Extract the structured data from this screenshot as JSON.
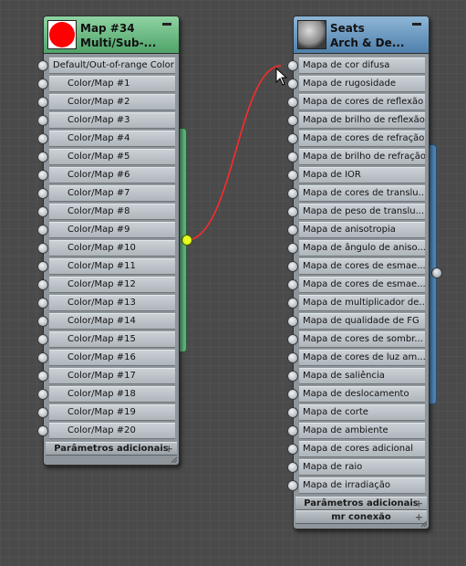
{
  "nodes": {
    "multi": {
      "title": "Map #34",
      "subtitle": "Multi/Sub-...",
      "thumb_color": "#ff0000",
      "header_color": "#5faf78",
      "slots": [
        "Default/Out-of-range Color",
        "Color/Map #1",
        "Color/Map #2",
        "Color/Map #3",
        "Color/Map #4",
        "Color/Map #5",
        "Color/Map #6",
        "Color/Map #7",
        "Color/Map #8",
        "Color/Map #9",
        "Color/Map #10",
        "Color/Map #11",
        "Color/Map #12",
        "Color/Map #13",
        "Color/Map #14",
        "Color/Map #15",
        "Color/Map #16",
        "Color/Map #17",
        "Color/Map #18",
        "Color/Map #19",
        "Color/Map #20"
      ],
      "rollouts": [
        "Parâmetros adicionais"
      ]
    },
    "seats": {
      "title": "Seats",
      "subtitle": "Arch & De...",
      "header_color": "#6a9cc6",
      "slots": [
        "Mapa de cor difusa",
        "Mapa de rugosidade",
        "Mapa de cores de reflexão",
        "Mapa de brilho de reflexão",
        "Mapa de cores de refração",
        "Mapa de brilho de refração",
        "Mapa de IOR",
        "Mapa de cores de translu...",
        "Mapa de peso de translu...",
        "Mapa de anisotropia",
        "Mapa de ângulo de aniso...",
        "Mapa de cores de esmae...",
        "Mapa de cores de esmae...",
        "Mapa de multiplicador de...",
        "Mapa de qualidade de FG",
        "Mapa de cores de sombr...",
        "Mapa de cores de luz am...",
        "Mapa de saliência",
        "Mapa de deslocamento",
        "Mapa de corte",
        "Mapa de ambiente",
        "Mapa de cores adicional",
        "Mapa de raio",
        "Mapa de irradiação"
      ],
      "rollouts": [
        "Parâmetros adicionais",
        "mr conexão"
      ]
    }
  },
  "wire": {
    "color": "#ff3030",
    "from": "Map #34 output",
    "to": "Mapa de cor difusa"
  },
  "icons": {
    "minimize": "minimize-icon",
    "expand": "plus-icon",
    "cursor": "arrow-cursor-icon",
    "output_socket_active": "#e6ff1f"
  }
}
